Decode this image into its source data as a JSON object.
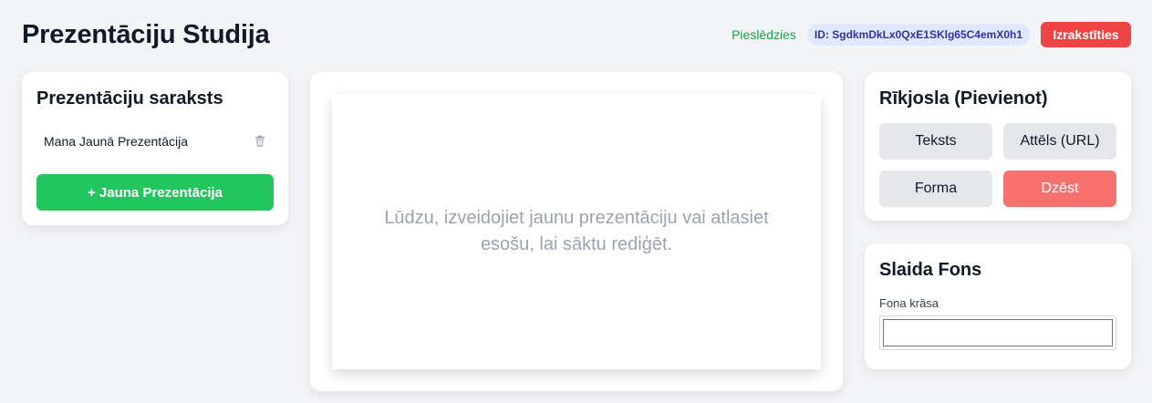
{
  "header": {
    "title": "Prezentāciju Studija",
    "status": "Pieslēdzies",
    "user_id": "ID: SgdkmDkLx0QxE1SKlg65C4emX0h1",
    "logout_label": "Izrakstīties"
  },
  "presentations_panel": {
    "title": "Prezentāciju saraksts",
    "items": [
      {
        "label": "Mana Jaunā Prezentācija",
        "icon": "trash-icon"
      }
    ],
    "new_button_label": "+ Jauna Prezentācija"
  },
  "editor": {
    "empty_message": "Lūdzu, izveidojiet jaunu prezentāciju vai atlasiet esošu, lai sāktu rediģēt."
  },
  "toolbar": {
    "title": "Rīkjosla (Pievienot)",
    "text_label": "Teksts",
    "image_label": "Attēls (URL)",
    "shape_label": "Forma",
    "delete_label": "Dzēst"
  },
  "slide_background": {
    "title": "Slaida Fons",
    "color_label": "Fona krāsa",
    "color_value": "#ffffff"
  },
  "colors": {
    "status_green": "#16a34a",
    "badge_bg": "#e0e7ff",
    "badge_text": "#3730a3",
    "logout_red": "#ef4444",
    "new_button_green": "#22c55e",
    "delete_red": "#f87171",
    "tool_button_gray": "#e5e7eb"
  }
}
